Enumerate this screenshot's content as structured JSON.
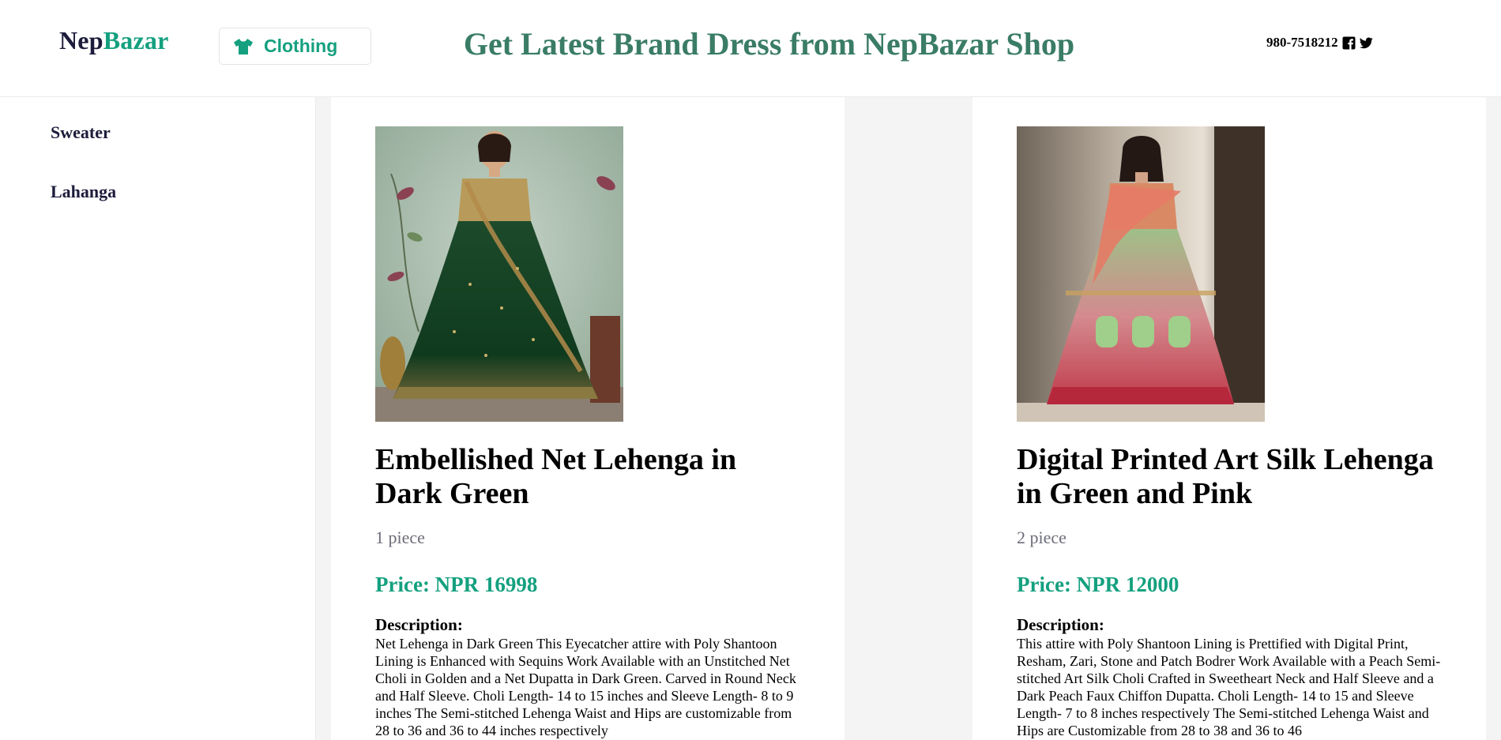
{
  "header": {
    "logo": {
      "part1": "Nep",
      "part2": "Bazar"
    },
    "category_button": {
      "label": "Clothing",
      "icon": "tshirt-icon"
    },
    "headline": "Get Latest Brand Dress from NepBazar Shop",
    "phone": "980-7518212",
    "social_icons": [
      "facebook-icon",
      "twitter-icon"
    ]
  },
  "sidebar": {
    "items": [
      {
        "label": "Sweater"
      },
      {
        "label": "Lahanga"
      }
    ]
  },
  "products": [
    {
      "title_line1": "Embellished Net Lehenga in",
      "title_line2": "Dark Green",
      "pieces": "1 piece",
      "price": "Price: NPR 16998",
      "description_heading": "Description:",
      "description": "Net Lehenga in Dark Green This Eyecatcher attire with Poly Shantoon Lining is Enhanced with Sequins Work Available with an Unstitched Net Choli in Golden and a Net Dupatta in Dark Green. Carved in Round Neck and Half Sleeve. Choli Length- 14 to 15 inches and Sleeve Length- 8 to 9 inches The Semi-stitched Lehenga Waist and Hips are customizable from 28 to 36 and 36 to 44 inches respectively"
    },
    {
      "title_line1": "Digital Printed Art Silk Lehenga",
      "title_line2": "in Green and Pink",
      "pieces": "2 piece",
      "price": "Price: NPR 12000",
      "description_heading": "Description:",
      "description": "This attire with Poly Shantoon Lining is Prettified with Digital Print, Resham, Zari, Stone and Patch Bodrer Work Available with a Peach Semi-stitched Art Silk Choli Crafted in Sweetheart Neck and Half Sleeve and a Dark Peach Faux Chiffon Dupatta. Choli Length- 14 to 15 and Sleeve Length- 7 to 8 inches respectively The Semi-stitched Lehenga Waist and Hips are Customizable from 28 to 38 and 36 to 46"
    }
  ],
  "colors": {
    "accent": "#14a07f",
    "headline": "#3a7c66",
    "navy": "#1d1c3b",
    "muted": "#6d6d7a"
  }
}
